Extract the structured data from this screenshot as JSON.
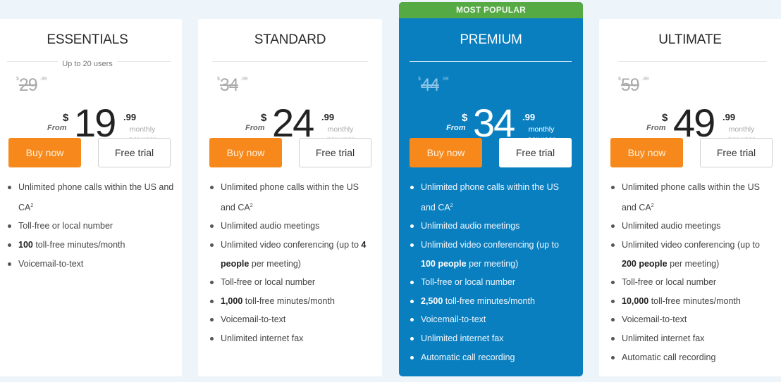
{
  "plans": [
    {
      "name": "ESSENTIALS",
      "subtitle": "Up to 20 users",
      "old_price": {
        "currency": "$",
        "whole": "29",
        "cents": ".99"
      },
      "price": {
        "from_label": "From",
        "currency": "$",
        "whole": "19",
        "cents": ".99",
        "period_line1": "monthly",
        "period_line2": "per user"
      },
      "buy_label": "Buy now",
      "trial_label": "Free trial",
      "features": [
        {
          "bold": "",
          "text": "Unlimited phone calls within the US and CA",
          "sup": "2"
        },
        {
          "bold": "",
          "text": "Toll-free or local number",
          "sup": ""
        },
        {
          "bold": "100",
          "text": " toll-free minutes/month",
          "sup": ""
        },
        {
          "bold": "",
          "text": "Voicemail-to-text",
          "sup": ""
        }
      ]
    },
    {
      "name": "STANDARD",
      "subtitle": "",
      "old_price": {
        "currency": "$",
        "whole": "34",
        "cents": ".99"
      },
      "price": {
        "from_label": "From",
        "currency": "$",
        "whole": "24",
        "cents": ".99",
        "period_line1": "monthly",
        "period_line2": "per user"
      },
      "buy_label": "Buy now",
      "trial_label": "Free trial",
      "features": [
        {
          "bold": "",
          "text": "Unlimited phone calls within the US and CA",
          "sup": "2"
        },
        {
          "bold": "",
          "text": "Unlimited audio meetings",
          "sup": ""
        },
        {
          "pre": "Unlimited video conferencing (up to ",
          "bold": "4 people",
          "text": " per meeting)",
          "sup": ""
        },
        {
          "bold": "",
          "text": "Toll-free or local number",
          "sup": ""
        },
        {
          "bold": "1,000",
          "text": " toll-free minutes/month",
          "sup": ""
        },
        {
          "bold": "",
          "text": "Voicemail-to-text",
          "sup": ""
        },
        {
          "bold": "",
          "text": "Unlimited internet fax",
          "sup": ""
        }
      ]
    },
    {
      "name": "PREMIUM",
      "badge": "MOST POPULAR",
      "subtitle": "",
      "old_price": {
        "currency": "$",
        "whole": "44",
        "cents": ".99"
      },
      "price": {
        "from_label": "From",
        "currency": "$",
        "whole": "34",
        "cents": ".99",
        "period_line1": "monthly",
        "period_line2": "per user"
      },
      "buy_label": "Buy now",
      "trial_label": "Free trial",
      "features": [
        {
          "bold": "",
          "text": "Unlimited phone calls within the US and CA",
          "sup": "2"
        },
        {
          "bold": "",
          "text": "Unlimited audio meetings",
          "sup": ""
        },
        {
          "pre": "Unlimited video conferencing (up to ",
          "bold": "100 people",
          "text": " per meeting)",
          "sup": ""
        },
        {
          "bold": "",
          "text": "Toll-free or local number",
          "sup": ""
        },
        {
          "bold": "2,500",
          "text": " toll-free minutes/month",
          "sup": ""
        },
        {
          "bold": "",
          "text": "Voicemail-to-text",
          "sup": ""
        },
        {
          "bold": "",
          "text": "Unlimited internet fax",
          "sup": ""
        },
        {
          "bold": "",
          "text": "Automatic call recording",
          "sup": ""
        }
      ]
    },
    {
      "name": "ULTIMATE",
      "subtitle": "",
      "old_price": {
        "currency": "$",
        "whole": "59",
        "cents": ".99"
      },
      "price": {
        "from_label": "From",
        "currency": "$",
        "whole": "49",
        "cents": ".99",
        "period_line1": "monthly",
        "period_line2": "per user"
      },
      "buy_label": "Buy now",
      "trial_label": "Free trial",
      "features": [
        {
          "bold": "",
          "text": "Unlimited phone calls within the US and CA",
          "sup": "2"
        },
        {
          "bold": "",
          "text": "Unlimited audio meetings",
          "sup": ""
        },
        {
          "pre": "Unlimited video conferencing (up to ",
          "bold": "200 people",
          "text": " per meeting)",
          "sup": ""
        },
        {
          "bold": "",
          "text": "Toll-free or local number",
          "sup": ""
        },
        {
          "bold": "10,000",
          "text": " toll-free minutes/month",
          "sup": ""
        },
        {
          "bold": "",
          "text": "Voicemail-to-text",
          "sup": ""
        },
        {
          "bold": "",
          "text": "Unlimited internet fax",
          "sup": ""
        },
        {
          "bold": "",
          "text": "Automatic call recording",
          "sup": ""
        }
      ]
    }
  ],
  "colors": {
    "page_bg": "#eef5fa",
    "featured_bg": "#0a7fc0",
    "badge_bg": "#55aa44",
    "buy_button": "#f7891c"
  }
}
